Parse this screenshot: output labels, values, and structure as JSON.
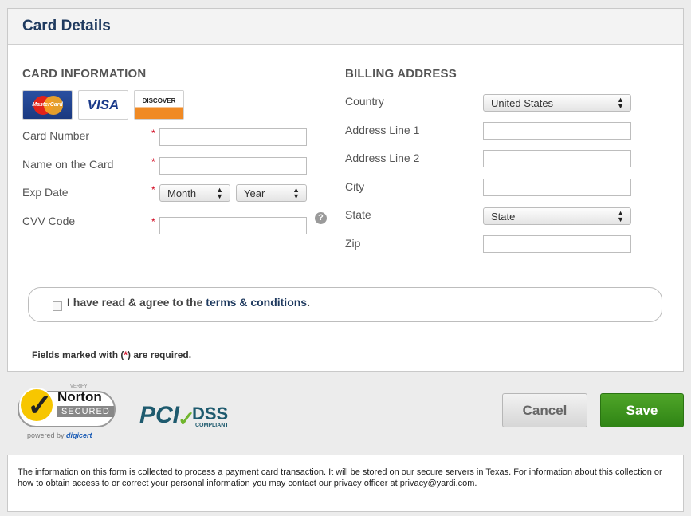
{
  "header": {
    "title": "Card Details"
  },
  "card_info": {
    "title": "CARD INFORMATION",
    "card_logos": {
      "mastercard": "MasterCard",
      "visa": "VISA",
      "discover": "DISCOVER"
    },
    "card_number_label": "Card Number",
    "card_number_value": "",
    "name_label": "Name on the Card",
    "name_value": "",
    "exp_label": "Exp Date",
    "exp_month": "Month",
    "exp_year": "Year",
    "cvv_label": "CVV Code",
    "cvv_value": "",
    "help_icon_glyph": "?",
    "required_marker": "*"
  },
  "billing": {
    "title": "BILLING ADDRESS",
    "country_label": "Country",
    "country_value": "United States",
    "address1_label": "Address Line 1",
    "address1_value": "",
    "address2_label": "Address Line 2",
    "address2_value": "",
    "city_label": "City",
    "city_value": "",
    "state_label": "State",
    "state_value": "State",
    "zip_label": "Zip",
    "zip_value": ""
  },
  "terms": {
    "text_before": "I have read & agree to the ",
    "link_text": "terms & conditions",
    "text_after": ".",
    "checked": false
  },
  "required_note": {
    "before": "Fields marked with (",
    "star": "*",
    "after": ") are required."
  },
  "badges": {
    "norton_verify": "VERIFY",
    "norton_brand": "Norton",
    "norton_secured": "SECURED",
    "norton_powered_prefix": "powered by ",
    "norton_powered_brand": "digicert",
    "pci": "PCI",
    "pci_dss": "DSS",
    "pci_compliant": "COMPLIANT"
  },
  "actions": {
    "cancel_label": "Cancel",
    "save_label": "Save"
  },
  "footer": {
    "notice": "The information on this form is collected to process a payment card transaction. It will be stored on our secure servers in Texas. For information about this collection or how to obtain access to or correct your personal information you may contact our privacy officer at privacy@yardi.com."
  },
  "colors": {
    "title": "#1f3a5f",
    "required": "#d0021b",
    "save_button": "#3d9620",
    "cancel_button": "#e0e0e0"
  },
  "icons": {
    "select_arrows": "⬍",
    "help": "question-circle-icon",
    "checkmark": "✔"
  }
}
